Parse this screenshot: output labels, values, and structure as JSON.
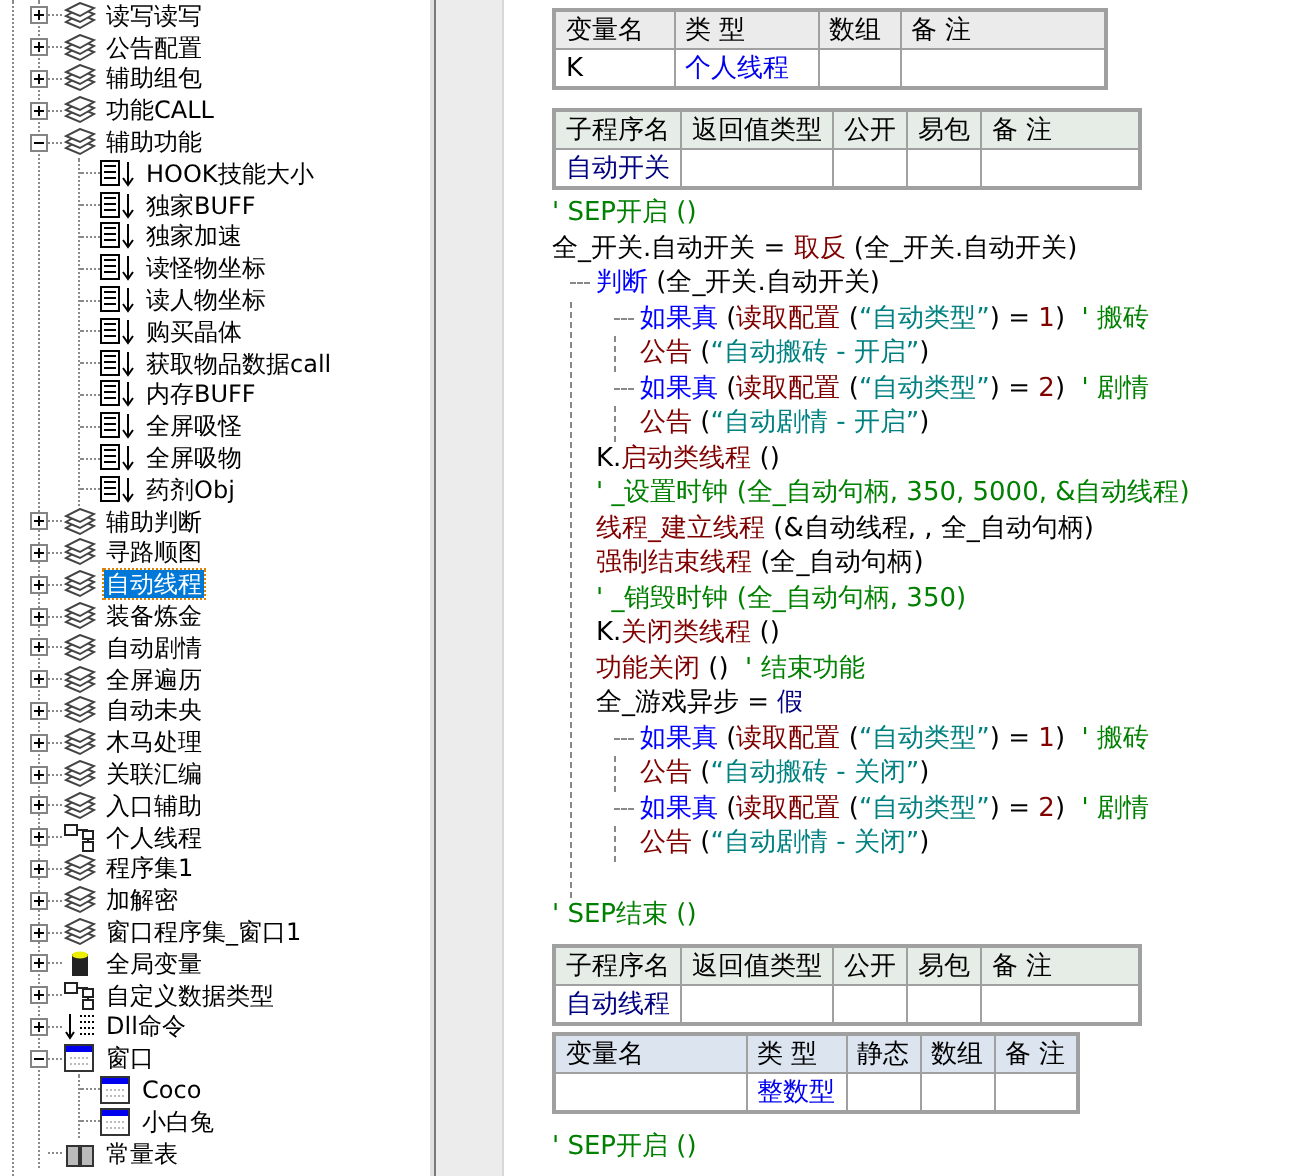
{
  "tree": [
    {
      "label": "读写读写",
      "kind": "module",
      "expanded": false,
      "selected": false
    },
    {
      "label": "公告配置",
      "kind": "module",
      "expanded": false,
      "selected": false
    },
    {
      "label": "辅助组包",
      "kind": "module",
      "expanded": false,
      "selected": false
    },
    {
      "label": "功能CALL",
      "kind": "module",
      "expanded": false,
      "selected": false
    },
    {
      "label": "辅助功能",
      "kind": "module",
      "expanded": true,
      "selected": false,
      "children": [
        {
          "label": "HOOK技能大小",
          "kind": "sub",
          "selected": false
        },
        {
          "label": "独家BUFF",
          "kind": "sub",
          "selected": false
        },
        {
          "label": "独家加速",
          "kind": "sub",
          "selected": false
        },
        {
          "label": "读怪物坐标",
          "kind": "sub",
          "selected": false
        },
        {
          "label": "读人物坐标",
          "kind": "sub",
          "selected": false
        },
        {
          "label": "购买晶体",
          "kind": "sub",
          "selected": false
        },
        {
          "label": "获取物品数据call",
          "kind": "sub",
          "selected": false
        },
        {
          "label": "内存BUFF",
          "kind": "sub",
          "selected": false
        },
        {
          "label": "全屏吸怪",
          "kind": "sub",
          "selected": false
        },
        {
          "label": "全屏吸物",
          "kind": "sub",
          "selected": false
        },
        {
          "label": "药剂Obj",
          "kind": "sub",
          "selected": false
        }
      ]
    },
    {
      "label": "辅助判断",
      "kind": "module",
      "expanded": false,
      "selected": false
    },
    {
      "label": "寻路顺图",
      "kind": "module",
      "expanded": false,
      "selected": false
    },
    {
      "label": "自动线程",
      "kind": "module",
      "expanded": false,
      "selected": true
    },
    {
      "label": "装备炼金",
      "kind": "module",
      "expanded": false,
      "selected": false
    },
    {
      "label": "自动剧情",
      "kind": "module",
      "expanded": false,
      "selected": false
    },
    {
      "label": "全屏遍历",
      "kind": "module",
      "expanded": false,
      "selected": false
    },
    {
      "label": "自动未央",
      "kind": "module",
      "expanded": false,
      "selected": false
    },
    {
      "label": "木马处理",
      "kind": "module",
      "expanded": false,
      "selected": false
    },
    {
      "label": "关联汇编",
      "kind": "module",
      "expanded": false,
      "selected": false
    },
    {
      "label": "入口辅助",
      "kind": "module",
      "expanded": false,
      "selected": false
    },
    {
      "label": "个人线程",
      "kind": "class",
      "expanded": false,
      "selected": false
    },
    {
      "label": "程序集1",
      "kind": "module",
      "expanded": false,
      "selected": false
    },
    {
      "label": "加解密",
      "kind": "module",
      "expanded": false,
      "selected": false
    },
    {
      "label": "窗口程序集_窗口1",
      "kind": "module",
      "expanded": false,
      "selected": false
    },
    {
      "label": "全局变量",
      "kind": "globals",
      "expanded": false,
      "selected": false
    },
    {
      "label": "自定义数据类型",
      "kind": "class",
      "expanded": false,
      "selected": false
    },
    {
      "label": "Dll命令",
      "kind": "dll",
      "expanded": false,
      "selected": false
    },
    {
      "label": "窗口",
      "kind": "window",
      "expanded": true,
      "selected": false,
      "children": [
        {
          "label": "Coco",
          "kind": "window",
          "selected": false
        },
        {
          "label": "小白兔",
          "kind": "window",
          "selected": false
        }
      ]
    },
    {
      "label": "常量表",
      "kind": "constants",
      "selected": false
    }
  ],
  "editor": {
    "var_table": {
      "columns": [
        "变量名",
        "类 型",
        "数组",
        "备 注"
      ],
      "rows": [
        [
          "K",
          "个人线程"
        ]
      ]
    },
    "sub_table": {
      "columns": [
        "子程序名",
        "返回值类型",
        "公开",
        "易包",
        "备 注"
      ],
      "rows": [
        [
          "自动开关"
        ]
      ]
    },
    "code": [
      {
        "segments": [
          {
            "kind": "comment",
            "text": "' SEP开启 ()"
          }
        ]
      },
      {
        "segments": [
          {
            "kind": "text",
            "text": "全_开关.自动开关 = "
          },
          {
            "kind": "command",
            "text": "取反"
          },
          {
            "kind": "text",
            "text": " (全_开关.自动开关)"
          }
        ]
      },
      {
        "segments": [
          {
            "kind": "keyword",
            "text": "判断"
          },
          {
            "kind": "text",
            "text": " (全_开关.自动开关)"
          }
        ],
        "children": [
          {
            "segments": [
              {
                "kind": "keyword",
                "text": "如果真"
              },
              {
                "kind": "text",
                "text": " ("
              },
              {
                "kind": "command",
                "text": "读取配置"
              },
              {
                "kind": "text",
                "text": " ("
              },
              {
                "kind": "string",
                "text": "“自动类型”"
              },
              {
                "kind": "text",
                "text": ") = "
              },
              {
                "kind": "number",
                "text": "1"
              },
              {
                "kind": "text",
                "text": ")  "
              },
              {
                "kind": "comment",
                "text": "' 搬砖"
              }
            ],
            "children": [
              {
                "segments": [
                  {
                    "kind": "command",
                    "text": "公告"
                  },
                  {
                    "kind": "text",
                    "text": " ("
                  },
                  {
                    "kind": "string",
                    "text": "“自动搬砖 - 开启”"
                  },
                  {
                    "kind": "text",
                    "text": ")"
                  }
                ]
              }
            ]
          },
          {
            "segments": [
              {
                "kind": "keyword",
                "text": "如果真"
              },
              {
                "kind": "text",
                "text": " ("
              },
              {
                "kind": "command",
                "text": "读取配置"
              },
              {
                "kind": "text",
                "text": " ("
              },
              {
                "kind": "string",
                "text": "“自动类型”"
              },
              {
                "kind": "text",
                "text": ") = "
              },
              {
                "kind": "number",
                "text": "2"
              },
              {
                "kind": "text",
                "text": ")  "
              },
              {
                "kind": "comment",
                "text": "' 剧情"
              }
            ],
            "children": [
              {
                "segments": [
                  {
                    "kind": "command",
                    "text": "公告"
                  },
                  {
                    "kind": "text",
                    "text": " ("
                  },
                  {
                    "kind": "string",
                    "text": "“自动剧情 - 开启”"
                  },
                  {
                    "kind": "text",
                    "text": ")"
                  }
                ]
              }
            ]
          },
          {
            "segments": [
              {
                "kind": "text",
                "text": "K."
              },
              {
                "kind": "command",
                "text": "启动类线程"
              },
              {
                "kind": "text",
                "text": " ()"
              }
            ]
          },
          {
            "segments": [
              {
                "kind": "comment",
                "text": "' _设置时钟 (全_自动句柄, 350, 5000, &自动线程)"
              }
            ]
          },
          {
            "segments": [
              {
                "kind": "command",
                "text": "线程_建立线程"
              },
              {
                "kind": "text",
                "text": " (&自动线程, , 全_自动句柄)"
              }
            ]
          },
          {
            "segments": [
              {
                "kind": "command",
                "text": "强制结束线程"
              },
              {
                "kind": "text",
                "text": " (全_自动句柄)"
              }
            ]
          },
          {
            "segments": [
              {
                "kind": "comment",
                "text": "' _销毁时钟 (全_自动句柄, 350)"
              }
            ]
          },
          {
            "segments": [
              {
                "kind": "text",
                "text": "K."
              },
              {
                "kind": "command",
                "text": "关闭类线程"
              },
              {
                "kind": "text",
                "text": " ()"
              }
            ]
          },
          {
            "segments": [
              {
                "kind": "command",
                "text": "功能关闭"
              },
              {
                "kind": "text",
                "text": " ()  "
              },
              {
                "kind": "comment",
                "text": "' 结束功能"
              }
            ]
          },
          {
            "segments": [
              {
                "kind": "text",
                "text": "全_游戏异步 = "
              },
              {
                "kind": "constant",
                "text": "假"
              }
            ]
          },
          {
            "segments": [
              {
                "kind": "keyword",
                "text": "如果真"
              },
              {
                "kind": "text",
                "text": " ("
              },
              {
                "kind": "command",
                "text": "读取配置"
              },
              {
                "kind": "text",
                "text": " ("
              },
              {
                "kind": "string",
                "text": "“自动类型”"
              },
              {
                "kind": "text",
                "text": ") = "
              },
              {
                "kind": "number",
                "text": "1"
              },
              {
                "kind": "text",
                "text": ")  "
              },
              {
                "kind": "comment",
                "text": "' 搬砖"
              }
            ],
            "children": [
              {
                "segments": [
                  {
                    "kind": "command",
                    "text": "公告"
                  },
                  {
                    "kind": "text",
                    "text": " ("
                  },
                  {
                    "kind": "string",
                    "text": "“自动搬砖 - 关闭”"
                  },
                  {
                    "kind": "text",
                    "text": ")"
                  }
                ]
              }
            ]
          },
          {
            "segments": [
              {
                "kind": "keyword",
                "text": "如果真"
              },
              {
                "kind": "text",
                "text": " ("
              },
              {
                "kind": "command",
                "text": "读取配置"
              },
              {
                "kind": "text",
                "text": " ("
              },
              {
                "kind": "string",
                "text": "“自动类型”"
              },
              {
                "kind": "text",
                "text": ") = "
              },
              {
                "kind": "number",
                "text": "2"
              },
              {
                "kind": "text",
                "text": ")  "
              },
              {
                "kind": "comment",
                "text": "' 剧情"
              }
            ],
            "children": [
              {
                "segments": [
                  {
                    "kind": "command",
                    "text": "公告"
                  },
                  {
                    "kind": "text",
                    "text": " ("
                  },
                  {
                    "kind": "string",
                    "text": "“自动剧情 - 关闭”"
                  },
                  {
                    "kind": "text",
                    "text": ")"
                  }
                ]
              }
            ]
          }
        ]
      },
      {
        "segments": [
          {
            "kind": "comment",
            "text": "' SEP结束 ()"
          }
        ]
      }
    ],
    "sub_table_2": {
      "columns": [
        "子程序名",
        "返回值类型",
        "公开",
        "易包",
        "备 注"
      ],
      "rows": [
        [
          "自动线程"
        ]
      ]
    },
    "local_table": {
      "columns": [
        "变量名",
        "类 型",
        "静态",
        "数组",
        "备 注"
      ],
      "rows": [
        [
          null,
          "整数型"
        ]
      ]
    },
    "trailing_code": [
      {
        "segments": [
          {
            "kind": "comment",
            "text": "' SEP开启 ()"
          }
        ]
      }
    ]
  }
}
